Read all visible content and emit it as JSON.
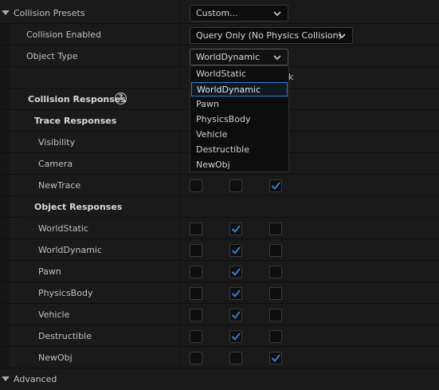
{
  "presets": {
    "label": "Collision Presets",
    "value": "Custom..."
  },
  "collision_enabled": {
    "label": "Collision Enabled",
    "value": "Query Only (No Physics Collision)"
  },
  "object_type": {
    "label": "Object Type",
    "value": "WorldDynamic"
  },
  "partial_text": "k",
  "collision_responses": {
    "label": "Collision Responses",
    "help_glyph": "?"
  },
  "trace_responses": {
    "label": "Trace Responses",
    "rows": [
      {
        "label": "Visibility",
        "checks": [
          false,
          false,
          false
        ]
      },
      {
        "label": "Camera",
        "checks": [
          false,
          false,
          false
        ]
      },
      {
        "label": "NewTrace",
        "checks": [
          false,
          false,
          true
        ]
      }
    ]
  },
  "object_responses": {
    "label": "Object Responses",
    "rows": [
      {
        "label": "WorldStatic",
        "checks": [
          false,
          true,
          false
        ]
      },
      {
        "label": "WorldDynamic",
        "checks": [
          false,
          true,
          false
        ]
      },
      {
        "label": "Pawn",
        "checks": [
          false,
          true,
          false
        ]
      },
      {
        "label": "PhysicsBody",
        "checks": [
          false,
          true,
          false
        ]
      },
      {
        "label": "Vehicle",
        "checks": [
          false,
          true,
          false
        ]
      },
      {
        "label": "Destructible",
        "checks": [
          false,
          true,
          false
        ]
      },
      {
        "label": "NewObj",
        "checks": [
          false,
          false,
          true
        ]
      }
    ]
  },
  "advanced": {
    "label": "Advanced"
  },
  "dropdown": {
    "items": [
      "WorldStatic",
      "WorldDynamic",
      "Pawn",
      "PhysicsBody",
      "Vehicle",
      "Destructible",
      "NewObj"
    ],
    "selected_index": 1
  },
  "colors": {
    "check": "#2f7fd6",
    "background": "#1a1a1a",
    "separator": "#0f0f0f"
  }
}
